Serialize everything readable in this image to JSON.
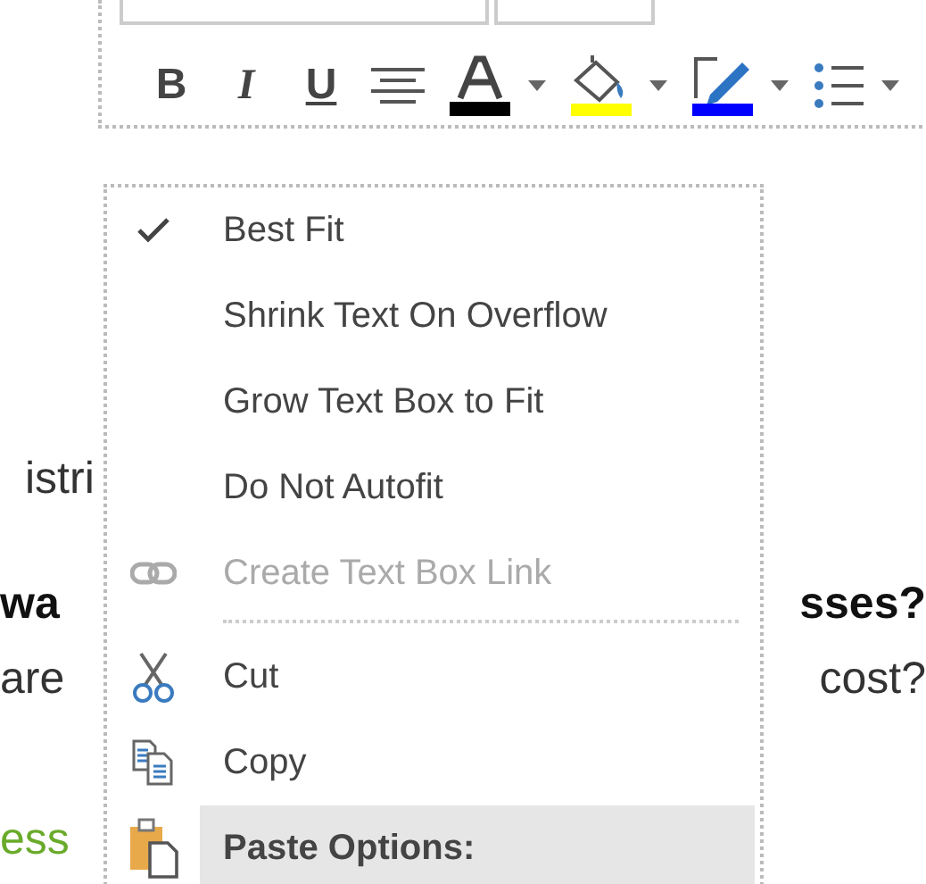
{
  "toolbar": {
    "buttons": [
      {
        "kind": "bold",
        "label": "B"
      },
      {
        "kind": "italic",
        "label": "I"
      },
      {
        "kind": "underline",
        "label": "U"
      },
      {
        "kind": "align"
      },
      {
        "kind": "font-color",
        "color": "#000000"
      },
      {
        "kind": "fill-color",
        "color": "#ffff00"
      },
      {
        "kind": "outline-color",
        "color": "#0000ff"
      },
      {
        "kind": "bullets"
      }
    ]
  },
  "document": {
    "lines": [
      {
        "left": "istri",
        "bold": false,
        "color": "#333333"
      },
      {
        "left": "wa",
        "right": "sses?",
        "bold": true,
        "color": "#111111"
      },
      {
        "left": "are",
        "right": "cost?",
        "bold": false,
        "color": "#333333"
      },
      {
        "left": "ess",
        "bold": false,
        "color": "#6aaa2a"
      }
    ]
  },
  "context_menu": {
    "items": [
      {
        "kind": "option",
        "label": "Best Fit",
        "checked": true
      },
      {
        "kind": "option",
        "label": "Shrink Text On Overflow",
        "checked": false
      },
      {
        "kind": "option",
        "label": "Grow Text Box to Fit",
        "checked": false
      },
      {
        "kind": "option",
        "label": "Do Not Autofit",
        "checked": false
      },
      {
        "kind": "link",
        "label": "Create Text Box Link",
        "disabled": true
      },
      {
        "kind": "separator"
      },
      {
        "kind": "cut",
        "label": "Cut",
        "disabled": false
      },
      {
        "kind": "copy",
        "label": "Copy",
        "disabled": false
      },
      {
        "kind": "paste-header",
        "label": "Paste Options:"
      }
    ]
  }
}
